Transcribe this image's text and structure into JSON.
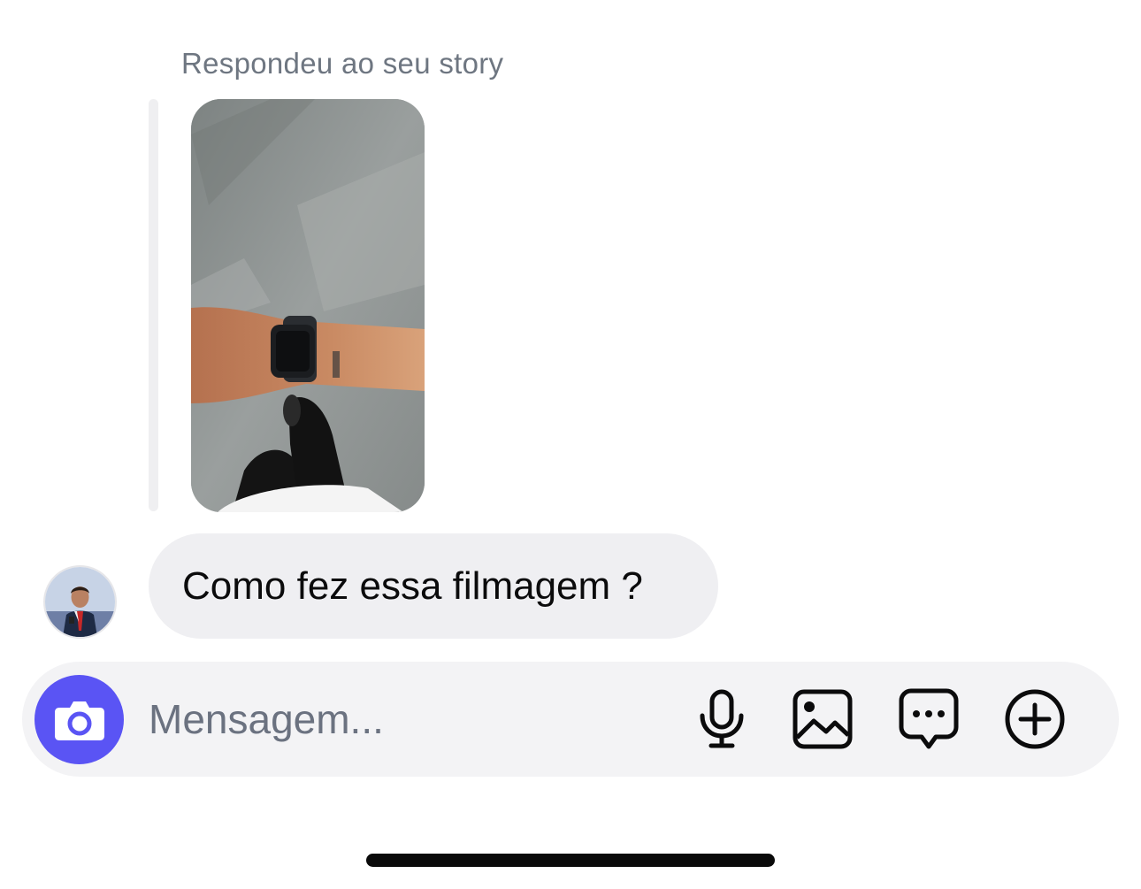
{
  "story_reply": {
    "caption": "Respondeu ao seu story"
  },
  "message": {
    "text": "Como fez essa filmagem ?"
  },
  "composer": {
    "placeholder": "Mensagem...",
    "icons": [
      "camera-icon",
      "microphone-icon",
      "gallery-icon",
      "sticker-chat-icon",
      "plus-circle-icon"
    ]
  },
  "colors": {
    "accent": "#5a54f4",
    "bubble": "#efeff2",
    "composer_bg": "#f3f3f5",
    "caption": "#6e7681"
  }
}
